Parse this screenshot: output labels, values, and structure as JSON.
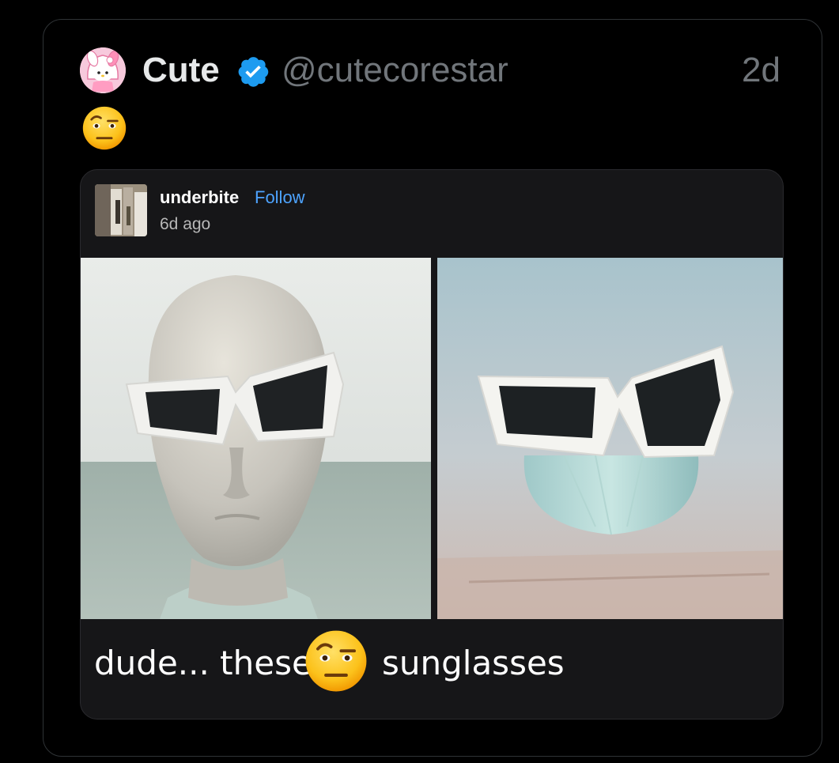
{
  "tweet": {
    "author_name": "Cute",
    "handle": "@cutecorestar",
    "time": "2d",
    "verified_icon": "verified-badge-icon",
    "avatar_icon": "my-melody-avatar",
    "body_emoji": "face-with-raised-eyebrow-emoji"
  },
  "quoted_post": {
    "username": "underbite",
    "follow_label": "Follow",
    "time": "6d ago",
    "images": [
      {
        "subject": "mannequin head wearing white sunglasses"
      },
      {
        "subject": "white sunglasses on a mint cone stand"
      }
    ],
    "caption": {
      "before": "dude... these",
      "emoji": "face-with-raised-eyebrow-emoji",
      "after": "sunglasses"
    }
  },
  "colors": {
    "background": "#000000",
    "name_text": "#e7e9ea",
    "secondary_text": "#71767b",
    "verified_blue": "#1d9bf0",
    "follow_blue": "#4da3ff",
    "card_bg": "#161618"
  }
}
